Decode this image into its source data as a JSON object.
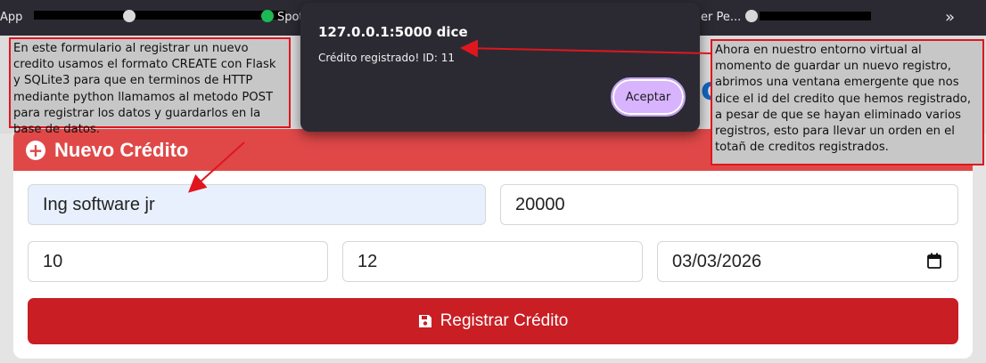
{
  "bookmarks": {
    "app_label": "App",
    "spotify_label": "Spot",
    "truncated_label": "er Pe...",
    "more_label": "»"
  },
  "annotations": {
    "left": "En este formulario al registrar un nuevo credito usamos el formato CREATE con Flask y SQLite3 para que en terminos de HTTP mediante python llamamos al metodo POST para registrar los datos y guardarlos en la base de datos.",
    "right": "Ahora en nuestro entorno virtual al momento de guardar un nuevo registro, abrimos una ventana emergente que nos dice el id del credito que hemos registrado, a pesar de que se hayan eliminado varios registros, esto para llevar un orden en el totañ de creditos registrados."
  },
  "background_fragment": "os",
  "form": {
    "title": "Nuevo Crédito",
    "credit_name": "Ing software jr",
    "amount": "20000",
    "rate": "10",
    "months": "12",
    "date": "03/03/2026",
    "submit_label": "Registrar Crédito"
  },
  "dialog": {
    "title": "127.0.0.1:5000 dice",
    "message": "Crédito registrado! ID: 11",
    "ok_label": "Aceptar"
  },
  "colors": {
    "header_red": "#e04848",
    "button_red": "#c81e24",
    "annotation_border": "#e0161f",
    "dialog_bg": "#2b2a33",
    "dialog_button": "#d8b4fe"
  }
}
